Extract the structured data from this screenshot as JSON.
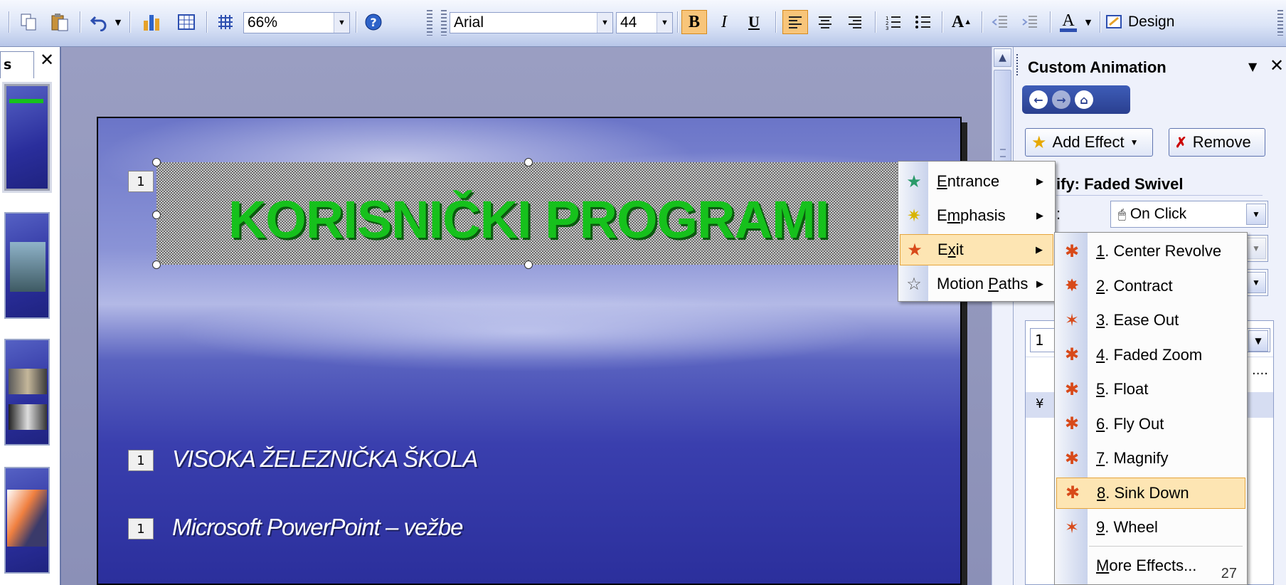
{
  "toolbar": {
    "zoom_value": "66%",
    "font_name": "Arial",
    "font_size": "44",
    "bold_label": "B",
    "italic_label": "I",
    "underline_label": "U",
    "design_label": "Design"
  },
  "left_panel": {
    "tab_label": "s",
    "close_glyph": "✕"
  },
  "slide": {
    "title": "KORISNIČKI PROGRAMI",
    "title_anim_tag": "1",
    "bullets": [
      {
        "tag": "1",
        "text": "VISOKA ŽELEZNIČKA ŠKOLA"
      },
      {
        "tag": "1",
        "text": "Microsoft PowerPoint – vežbe"
      }
    ]
  },
  "task_pane": {
    "title": "Custom Animation",
    "add_effect_label": "Add Effect",
    "remove_label": "Remove",
    "modify_label": "ify: Faded Swivel",
    "start_label": ":",
    "start_value": "On Click",
    "list_number": "1",
    "list_ellipsis": "....",
    "list_expand": "¥"
  },
  "add_effect_menu": {
    "items": [
      {
        "label": "Entrance",
        "accel": "E",
        "rest": "ntrance",
        "icon": "entrance-star-icon"
      },
      {
        "label": "Emphasis",
        "accel": "m",
        "pre": "E",
        "rest": "phasis",
        "icon": "emphasis-star-icon"
      },
      {
        "label": "Exit",
        "accel": "x",
        "pre": "E",
        "rest": "it",
        "icon": "exit-star-icon"
      },
      {
        "label": "Motion Paths",
        "accel": "P",
        "pre": "Motion ",
        "rest": "aths",
        "icon": "motion-path-star-icon"
      }
    ]
  },
  "exit_submenu": {
    "items": [
      {
        "num": "1",
        "rest": ". Center Revolve"
      },
      {
        "num": "2",
        "rest": ". Contract"
      },
      {
        "num": "3",
        "rest": ". Ease Out"
      },
      {
        "num": "4",
        "rest": ". Faded Zoom"
      },
      {
        "num": "5",
        "rest": ". Float"
      },
      {
        "num": "6",
        "rest": ". Fly Out"
      },
      {
        "num": "7",
        "rest": ". Magnify"
      },
      {
        "num": "8",
        "rest": ". Sink Down"
      },
      {
        "num": "9",
        "rest": ". Wheel"
      }
    ],
    "more_label": "More Effects...",
    "more_accel": "M",
    "more_rest": "ore Effects...",
    "page_number": "27"
  },
  "colors": {
    "title_green": "#16c11c",
    "menu_highlight": "#fde5b3",
    "taskpane_blue": "#2a3f8f"
  }
}
